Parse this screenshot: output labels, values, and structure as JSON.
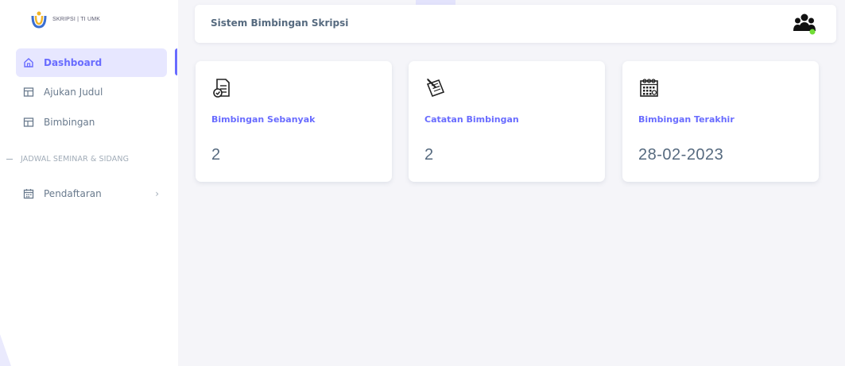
{
  "brand": {
    "text": "SKRIPSI | TI UMK"
  },
  "sidebar": {
    "items": [
      {
        "label": "Dashboard",
        "icon": "home-icon",
        "active": true
      },
      {
        "label": "Ajukan Judul",
        "icon": "layout-icon",
        "active": false
      },
      {
        "label": "Bimbingan",
        "icon": "layout-icon",
        "active": false
      }
    ],
    "section_header": "JADWAL SEMINAR & SIDANG",
    "submenu": {
      "label": "Pendaftaran",
      "icon": "calendar-icon",
      "chevron": "›"
    }
  },
  "header": {
    "title": "Sistem Bimbingan Skripsi",
    "user_icon": "users-icon",
    "status_color": "#71dd37"
  },
  "cards": [
    {
      "label": "Bimbingan Sebanyak",
      "value": "2",
      "icon": "document-check-icon"
    },
    {
      "label": "Catatan Bimbingan",
      "value": "2",
      "icon": "notes-pencil-icon"
    },
    {
      "label": "Bimbingan Terakhir",
      "value": "28-02-2023",
      "icon": "calendar-grid-icon"
    }
  ],
  "colors": {
    "accent": "#696cff",
    "accent_light": "#e7e7ff",
    "background": "#f5f5f9",
    "text": "#566a7f"
  }
}
